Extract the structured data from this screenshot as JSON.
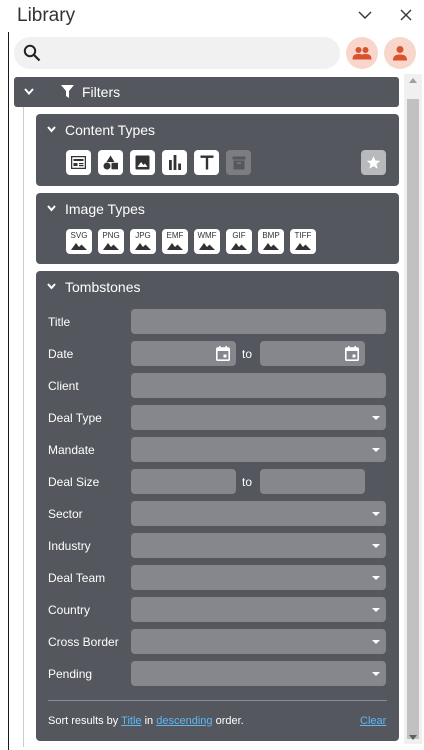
{
  "window": {
    "title": "Library"
  },
  "search": {
    "placeholder": "",
    "value": ""
  },
  "colors": {
    "panel": "#55575e",
    "field": "#85878c",
    "accent_button": "#f8d6cb",
    "accent_icon": "#d9532c",
    "link": "#5fb8f2"
  },
  "icons": {
    "search": "search-icon",
    "group": "group-icon",
    "user": "user-icon",
    "filter": "filter-icon",
    "star": "star-icon"
  },
  "filters": {
    "label": "Filters",
    "content_types": {
      "title": "Content Types",
      "items": [
        "table-layout-icon",
        "shapes-icon",
        "image-icon",
        "bar-chart-icon",
        "text-icon",
        "archive-icon"
      ]
    },
    "image_types": {
      "title": "Image Types",
      "items": [
        "SVG",
        "PNG",
        "JPG",
        "EMF",
        "WMF",
        "GIF",
        "BMP",
        "TIFF"
      ]
    },
    "tombstones": {
      "title": "Tombstones",
      "to_label": "to",
      "fields": {
        "title": "Title",
        "date": "Date",
        "client": "Client",
        "deal_type": "Deal Type",
        "mandate": "Mandate",
        "deal_size": "Deal Size",
        "sector": "Sector",
        "industry": "Industry",
        "deal_team": "Deal Team",
        "country": "Country",
        "cross_border": "Cross Border",
        "pending": "Pending"
      },
      "sort": {
        "prefix": "Sort results by",
        "field": "Title",
        "middle": "in",
        "order": "descending",
        "suffix": "order.",
        "clear": "Clear"
      }
    }
  }
}
